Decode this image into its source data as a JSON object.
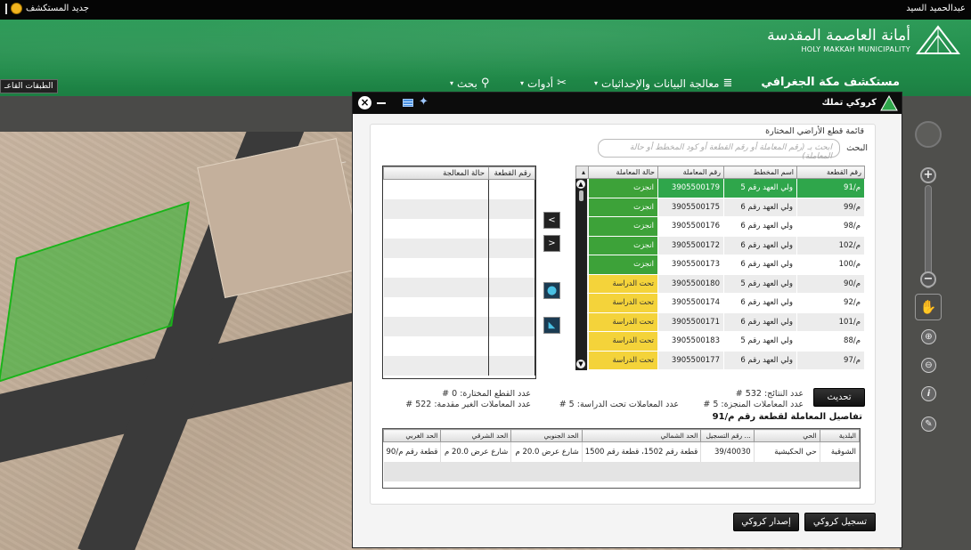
{
  "topbar": {
    "user": "عبدالحميد السيد",
    "new_explorer": "جديد المستكشف"
  },
  "header": {
    "logo_ar": "أمانة العاصمة المقدسة",
    "logo_en": "HOLY MAKKAH MUNICIPALITY",
    "app_title": "مستكشف مكة الجغرافي",
    "menu": [
      {
        "label": "معالجة البيانات والإحداثيات",
        "icon": "database-icon"
      },
      {
        "label": "أدوات",
        "icon": "tools-icon"
      },
      {
        "label": "بحث",
        "icon": "search-icon"
      }
    ],
    "layers_button": "الطبقات القاعـ"
  },
  "dialog": {
    "title": "كروكي تملك",
    "list_title": "قائمة قطع الأراضي المختارة",
    "search_label": "البحث",
    "search_placeholder": "ابحث بـ (رقم المعاملة أو رقم القطعة أو كود المخطط أو حالة المعاملة)",
    "main_columns": [
      "رقم القطعة",
      "اسم المخطط",
      "رقم المعاملة",
      "حالة المعاملة"
    ],
    "main_rows": [
      {
        "parcel": "م/91",
        "plan": "ولي العهد رقم 5",
        "transaction": "3905500179",
        "status": "انجزت",
        "status_type": "done",
        "selected": true
      },
      {
        "parcel": "م/99",
        "plan": "ولي العهد رقم 6",
        "transaction": "3905500175",
        "status": "انجزت",
        "status_type": "done"
      },
      {
        "parcel": "م/98",
        "plan": "ولي العهد رقم 6",
        "transaction": "3905500176",
        "status": "انجزت",
        "status_type": "done"
      },
      {
        "parcel": "م/102",
        "plan": "ولي العهد رقم 6",
        "transaction": "3905500172",
        "status": "انجزت",
        "status_type": "done"
      },
      {
        "parcel": "م/100",
        "plan": "ولي العهد رقم 6",
        "transaction": "3905500173",
        "status": "انجزت",
        "status_type": "done"
      },
      {
        "parcel": "م/90",
        "plan": "ولي العهد رقم 5",
        "transaction": "3905500180",
        "status": "تحت الدراسة",
        "status_type": "study"
      },
      {
        "parcel": "م/92",
        "plan": "ولي العهد رقم 6",
        "transaction": "3905500174",
        "status": "تحت الدراسة",
        "status_type": "study"
      },
      {
        "parcel": "م/101",
        "plan": "ولي العهد رقم 6",
        "transaction": "3905500171",
        "status": "تحت الدراسة",
        "status_type": "study"
      },
      {
        "parcel": "م/88",
        "plan": "ولي العهد رقم 5",
        "transaction": "3905500183",
        "status": "تحت الدراسة",
        "status_type": "study"
      },
      {
        "parcel": "م/97",
        "plan": "ولي العهد رقم 6",
        "transaction": "3905500177",
        "status": "تحت الدراسة",
        "status_type": "study"
      }
    ],
    "side_columns": [
      "رقم القطعة",
      "حالة المعالجة"
    ],
    "side_row_count": 10,
    "btn_left": "<",
    "btn_right": ">",
    "update_button": "تحديث",
    "stats": {
      "results": "# عدد النتائج:  532",
      "done": "# عدد المعاملات المنجزة:  5",
      "study": "# عدد المعاملات تحت الدراسة:  5",
      "selected": "# عدد القطع المختارة:  0",
      "not_submitted": "# عدد المعاملات الغير مقدمة:  522"
    },
    "detail_title": "تفاصيل المعاملة لقطعة رقم م/91",
    "detail_columns": [
      "البلدية",
      "الحي",
      "رقم التسجيل ...",
      "الحد الشمالي",
      "الحد الجنوبي",
      "الحد الشرقي",
      "الحد الغربي"
    ],
    "detail_row": [
      "الشوقية",
      "حي الحكيشية",
      "39/40030",
      "قطعة رقم 1502، قطعة رقم 1500",
      "شارع عرض 20.0 م",
      "شارع عرض 20.0 م",
      "قطعة رقم م/90"
    ],
    "register_button": "تسجيل كروكي",
    "issue_button": "إصدار كروكي"
  },
  "colors": {
    "header_green": "#1f8a48",
    "done_green": "#3da239",
    "study_yellow": "#f4d33a",
    "selected_row": "#2fa64b"
  }
}
